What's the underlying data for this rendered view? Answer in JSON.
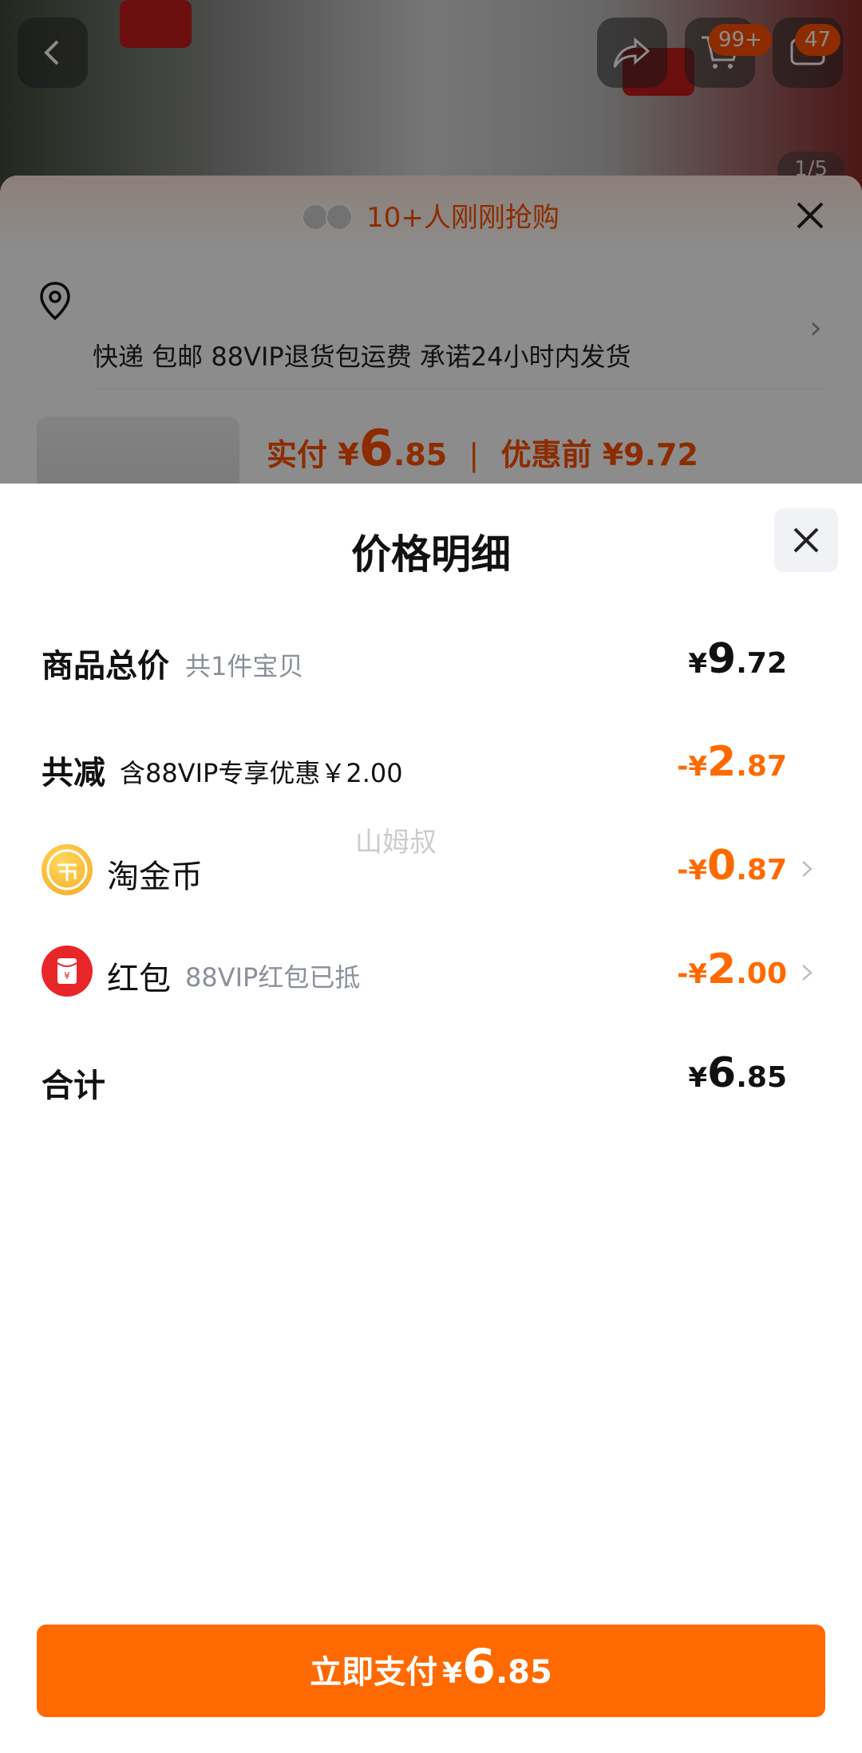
{
  "background": {
    "cart_badge": "99+",
    "messages_badge": "47",
    "image_counter": "1/5"
  },
  "sheet": {
    "banner": "10+人刚刚抢购",
    "shipping": "快递 包邮 88VIP退货包运费 承诺24小时内发货",
    "actual_label": "实付",
    "actual_cur": "¥",
    "actual_int": "6",
    "actual_dec": ".85",
    "before_label": "优惠前",
    "before_price": "¥9.72"
  },
  "modal": {
    "title": "价格明细",
    "rows": [
      {
        "label": "商品总价",
        "sub": "共1件宝贝",
        "cur": "¥",
        "int": "9",
        "dec": ".72",
        "color": "#111111"
      },
      {
        "label": "共减",
        "sub": "含88VIP专享优惠￥2.00",
        "cur": "-¥",
        "int": "2",
        "dec": ".87",
        "color": "#ff6a00"
      },
      {
        "label": "淘金币",
        "sub": "",
        "cur": "-¥",
        "int": "0",
        "dec": ".87",
        "color": "#ff6a00",
        "icon": "gold-coin-icon"
      },
      {
        "label": "红包",
        "sub": "88VIP红包已抵",
        "cur": "-¥",
        "int": "2",
        "dec": ".00",
        "color": "#ff6a00",
        "icon": "red-packet-icon"
      },
      {
        "label": "合计",
        "sub": "",
        "cur": "¥",
        "int": "6",
        "dec": ".85",
        "color": "#111111"
      }
    ],
    "watermark": "山姆叔"
  },
  "pay_button": {
    "label": "立即支付",
    "cur": "¥",
    "int": "6",
    "dec": ".85"
  },
  "colors": {
    "accent": "#ff6a00",
    "brand": "#ff5000"
  }
}
